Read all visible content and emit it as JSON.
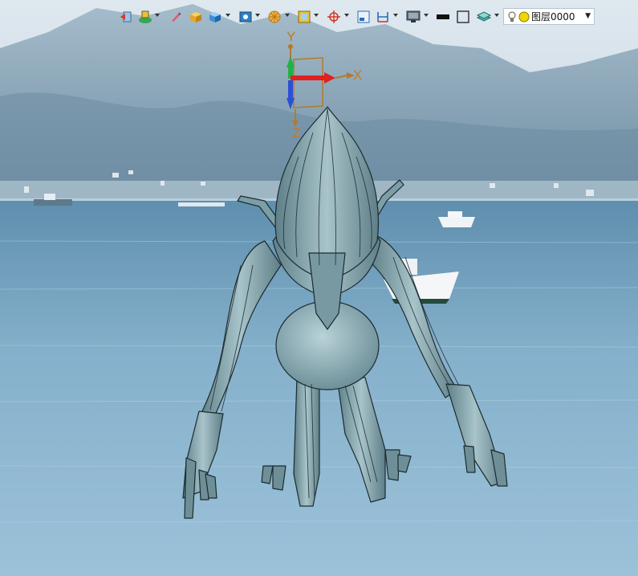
{
  "toolbar": {
    "buttons": [
      {
        "id": "exit-sketch",
        "icon": "exit-icon"
      },
      {
        "id": "display-style",
        "icon": "display-style-icon"
      },
      {
        "id": "pen",
        "icon": "pen-icon"
      },
      {
        "id": "solid",
        "icon": "cube-icon"
      },
      {
        "id": "solid-blue",
        "icon": "cube-blue-icon"
      },
      {
        "id": "face",
        "icon": "face-icon"
      },
      {
        "id": "render",
        "icon": "render-wheel-icon"
      },
      {
        "id": "frame",
        "icon": "frame-icon"
      },
      {
        "id": "snap",
        "icon": "target-icon"
      },
      {
        "id": "window",
        "icon": "window-icon"
      },
      {
        "id": "dimension",
        "icon": "dimension-icon"
      },
      {
        "id": "monitor",
        "icon": "monitor-icon"
      },
      {
        "id": "line-color",
        "icon": "line-color-icon"
      },
      {
        "id": "box",
        "icon": "box-outline-icon"
      },
      {
        "id": "layers",
        "icon": "layers-icon"
      }
    ],
    "layer_select": {
      "value": "图层0000",
      "icon": "lightbulb-icon",
      "color": "#f2d600"
    }
  },
  "triad": {
    "x_label": "X",
    "y_label": "Y",
    "z_label": "Z",
    "x_color": "#e02020",
    "y_color": "#22b04a",
    "z_color": "#2a4fd8",
    "label_color": "#c07a28"
  },
  "model": {
    "name": "alien-creature",
    "surface_color": "#7e9fa6"
  },
  "background": {
    "sky_color": "#d4e1ea",
    "mountain_color": "#7f9cae",
    "water_color": "#7fa9c6"
  }
}
